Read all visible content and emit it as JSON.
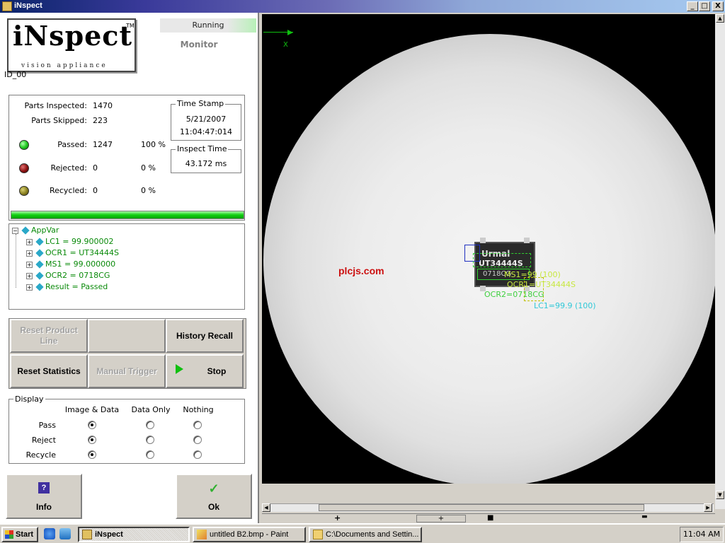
{
  "window": {
    "title": "iNspect",
    "min": "_",
    "max": "□",
    "close": "X"
  },
  "logo": {
    "brand": "iNspect",
    "tm": "TM",
    "tagline": "vision appliance"
  },
  "status": {
    "running": "Running",
    "mode": "Monitor"
  },
  "device_id": "ID_00",
  "stats": {
    "parts_inspected_label": "Parts Inspected:",
    "parts_inspected": "1470",
    "parts_skipped_label": "Parts Skipped:",
    "parts_skipped": "223",
    "passed_label": "Passed:",
    "passed": "1247",
    "passed_pct": "100 %",
    "rejected_label": "Rejected:",
    "rejected": "0",
    "rejected_pct": "0 %",
    "recycled_label": "Recycled:",
    "recycled": "0",
    "recycled_pct": "0 %",
    "led_colors": {
      "passed": "#22cc22",
      "rejected": "#8b1010",
      "recycled": "#8a8020"
    }
  },
  "timestamp": {
    "caption": "Time Stamp",
    "date": "5/21/2007",
    "time": "11:04:47:014"
  },
  "inspect_time": {
    "caption": "Inspect Time",
    "value": "43.172 ms"
  },
  "progress": {
    "value": 1.0
  },
  "tree": {
    "root": "AppVar",
    "items": [
      "LC1 = 99.900002",
      "OCR1 = UT34444S",
      "MS1 = 99.000000",
      "OCR2 = 0718CG",
      "Result = Passed"
    ]
  },
  "buttons": {
    "reset_product_line": "Reset Product Line",
    "history_recall": "History Recall",
    "reset_statistics": "Reset Statistics",
    "manual_trigger": "Manual Trigger",
    "stop": "Stop"
  },
  "display": {
    "caption": "Display",
    "columns": [
      "Image & Data",
      "Data Only",
      "Nothing"
    ],
    "rows": [
      "Pass",
      "Reject",
      "Recycle"
    ]
  },
  "bottom_buttons": {
    "info": "Info",
    "ok": "Ok",
    "info_icon": "?"
  },
  "image": {
    "watermark": "plcjs.com",
    "x_label": "X",
    "chip_text_1": "Urmal",
    "chip_text_2": "UT34444S",
    "chip_text_3": "0718CG",
    "ovl_ms1": "MS1=99 (100)",
    "ovl_ocr1": "OCR1=UT34444S",
    "ovl_ocr2": "OCR2=0718CG",
    "ovl_lc1": "LC1=99.9 (100)"
  },
  "image_toolbar": {
    "plus": "+",
    "square": "■",
    "minus": "▬",
    "small_plus": "+"
  },
  "taskbar": {
    "start": "Start",
    "tasks": [
      "iNspect",
      "untitled B2.bmp - Paint",
      "C:\\Documents and Settin..."
    ],
    "clock": "11:04 AM"
  }
}
